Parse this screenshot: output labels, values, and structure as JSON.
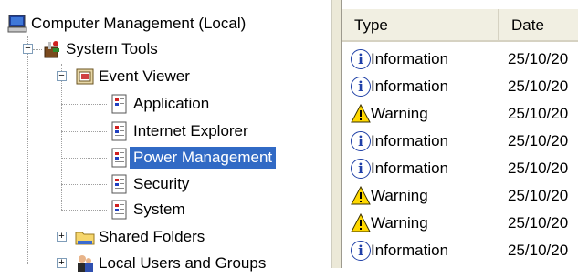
{
  "tree": {
    "root": {
      "label": "Computer Management (Local)",
      "icon": "computer-icon"
    },
    "system_tools": {
      "label": "System Tools",
      "expander": "−",
      "icon": "toolbox-icon"
    },
    "event_viewer": {
      "label": "Event Viewer",
      "expander": "−",
      "icon": "event-viewer-icon"
    },
    "logs": [
      {
        "label": "Application",
        "icon": "log-icon"
      },
      {
        "label": "Internet Explorer",
        "icon": "log-icon"
      },
      {
        "label": "Power Management",
        "icon": "log-icon",
        "selected": true
      },
      {
        "label": "Security",
        "icon": "log-icon"
      },
      {
        "label": "System",
        "icon": "log-icon"
      }
    ],
    "shared_folders": {
      "label": "Shared Folders",
      "expander": "+",
      "icon": "folder-icon"
    },
    "local_users": {
      "label": "Local Users and Groups",
      "expander": "+",
      "icon": "users-icon"
    }
  },
  "list": {
    "columns": {
      "type": "Type",
      "date": "Date"
    },
    "rows": [
      {
        "type": "Information",
        "icon": "info-icon",
        "date": "25/10/20"
      },
      {
        "type": "Information",
        "icon": "info-icon",
        "date": "25/10/20"
      },
      {
        "type": "Warning",
        "icon": "warning-icon",
        "date": "25/10/20"
      },
      {
        "type": "Information",
        "icon": "info-icon",
        "date": "25/10/20"
      },
      {
        "type": "Information",
        "icon": "info-icon",
        "date": "25/10/20"
      },
      {
        "type": "Warning",
        "icon": "warning-icon",
        "date": "25/10/20"
      },
      {
        "type": "Warning",
        "icon": "warning-icon",
        "date": "25/10/20"
      },
      {
        "type": "Information",
        "icon": "info-icon",
        "date": "25/10/20"
      }
    ]
  },
  "colors": {
    "selection": "#316ac5",
    "header_bg": "#f1efe2",
    "info_blue": "#1f3fa8",
    "warning_yellow": "#ffd800"
  }
}
